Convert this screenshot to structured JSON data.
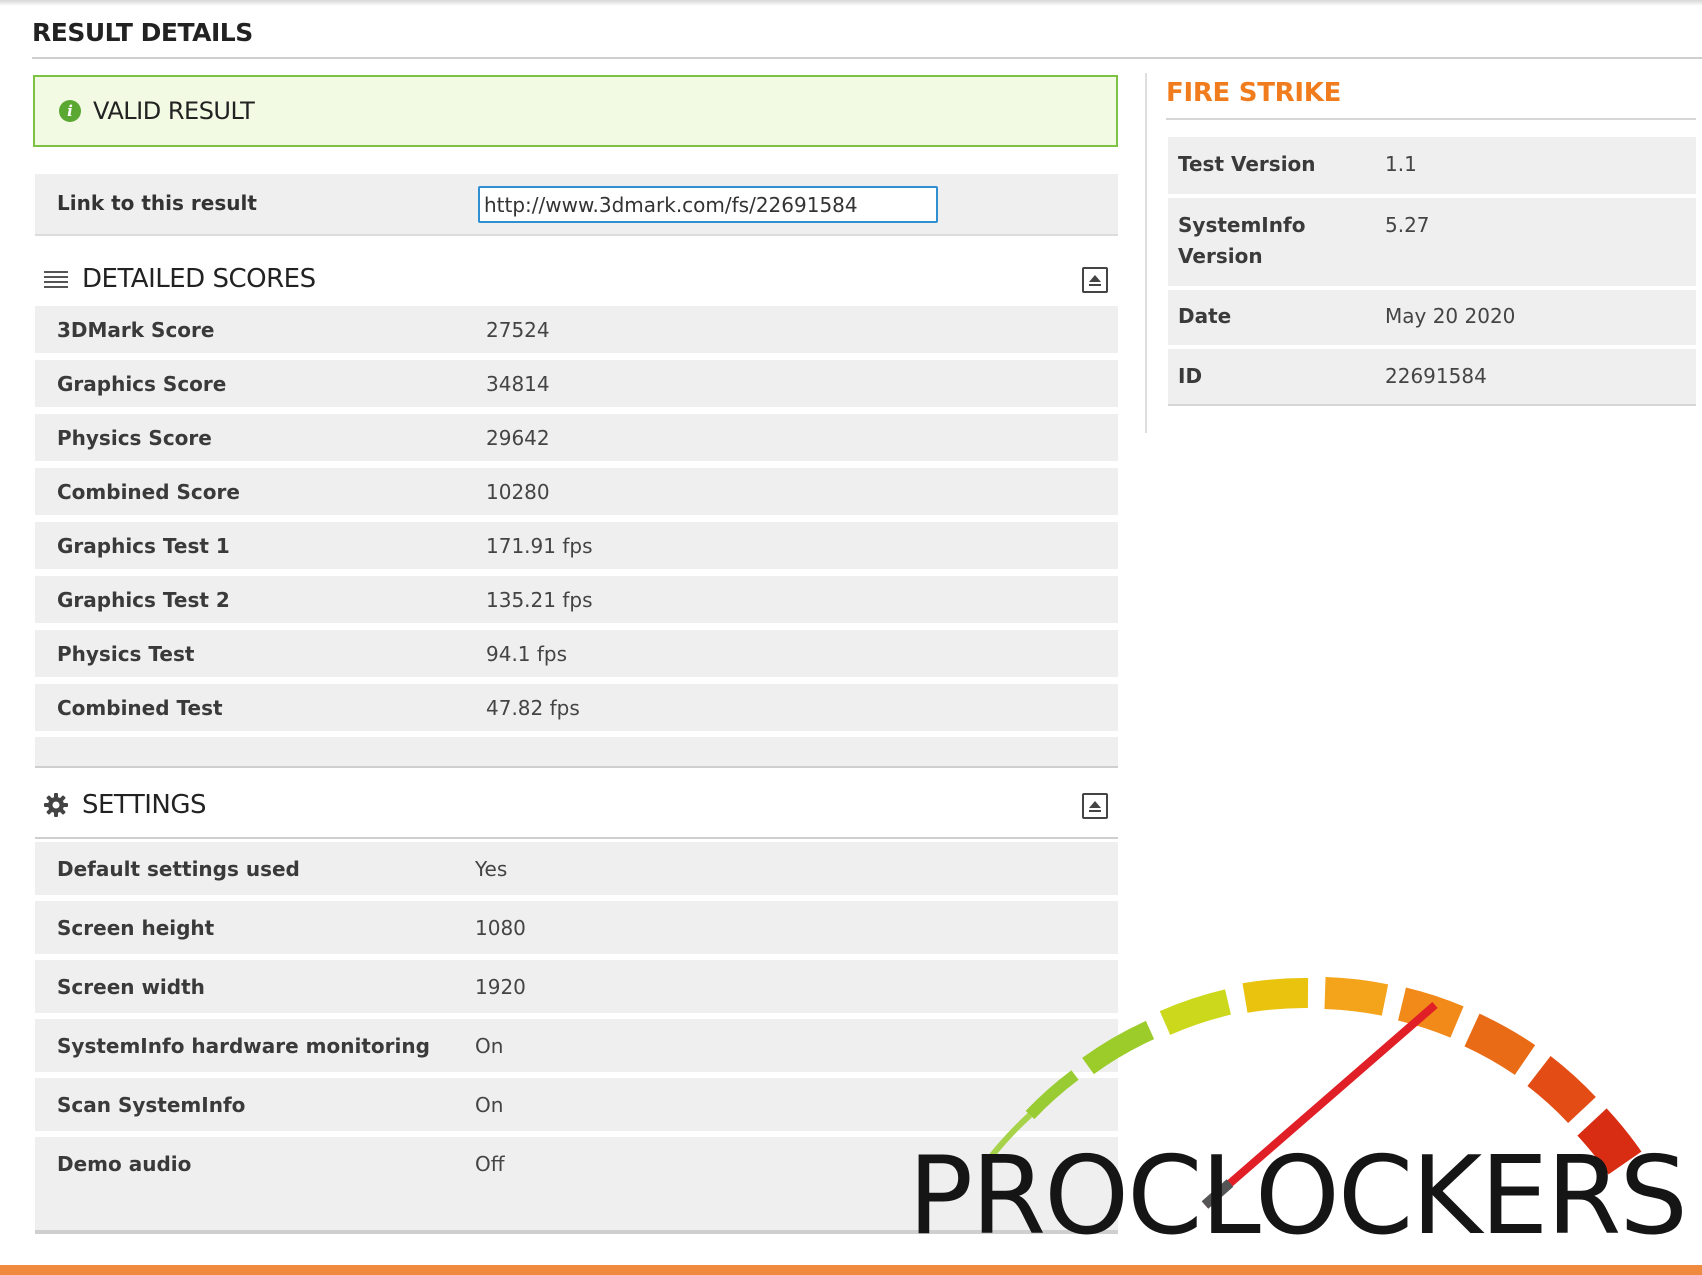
{
  "page": {
    "title": "RESULT DETAILS"
  },
  "valid": {
    "label": "VALID RESULT",
    "icon": "info-icon",
    "color": "#7dc242"
  },
  "link": {
    "label": "Link to this result",
    "value": "http://www.3dmark.com/fs/22691584"
  },
  "scores": {
    "title": "DETAILED SCORES",
    "icon": "list-icon",
    "rows": [
      {
        "label": "3DMark Score",
        "value": "27524"
      },
      {
        "label": "Graphics Score",
        "value": "34814"
      },
      {
        "label": "Physics Score",
        "value": "29642"
      },
      {
        "label": "Combined Score",
        "value": "10280"
      },
      {
        "label": "Graphics Test 1",
        "value": "171.91 fps"
      },
      {
        "label": "Graphics Test 2",
        "value": "135.21 fps"
      },
      {
        "label": "Physics Test",
        "value": "94.1 fps"
      },
      {
        "label": "Combined Test",
        "value": "47.82 fps"
      }
    ]
  },
  "settings": {
    "title": "SETTINGS",
    "icon": "gear-icon",
    "rows": [
      {
        "label": "Default settings used",
        "value": "Yes"
      },
      {
        "label": "Screen height",
        "value": "1080"
      },
      {
        "label": "Screen width",
        "value": "1920"
      },
      {
        "label": "SystemInfo hardware monitoring",
        "value": "On"
      },
      {
        "label": "Scan SystemInfo",
        "value": "On"
      },
      {
        "label": "Demo audio",
        "value": "Off"
      }
    ]
  },
  "firestrike": {
    "title": "FIRE STRIKE",
    "accent": "#f07c1d",
    "rows": [
      {
        "label_line1": "Test Version",
        "label_line2": "",
        "value": "1.1"
      },
      {
        "label_line1": "SystemInfo",
        "label_line2": "Version",
        "value": "5.27"
      },
      {
        "label_line1": "Date",
        "label_line2": "",
        "value": "May 20 2020"
      },
      {
        "label_line1": "ID",
        "label_line2": "",
        "value": "22691584"
      }
    ]
  },
  "watermark": {
    "text": "PROCLOCKERS",
    "icon": "speedometer-logo"
  }
}
